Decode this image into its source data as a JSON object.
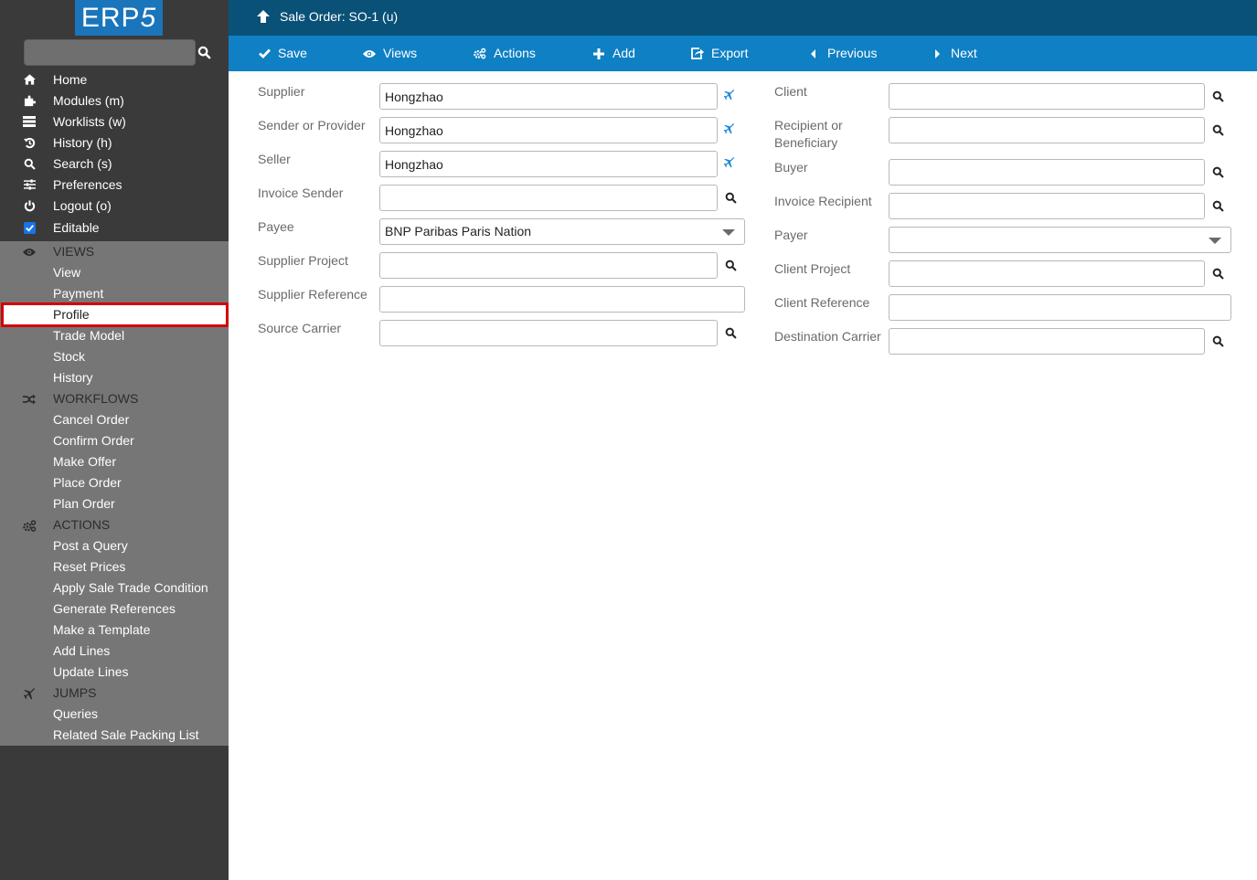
{
  "app": {
    "logo_text": "ERP",
    "logo_suffix": "5"
  },
  "sidebar": {
    "search_placeholder": "",
    "items": [
      {
        "label": "Home",
        "icon": "home-icon"
      },
      {
        "label": "Modules (m)",
        "icon": "puzzle-icon"
      },
      {
        "label": "Worklists (w)",
        "icon": "worklist-icon"
      },
      {
        "label": "History (h)",
        "icon": "history-icon"
      },
      {
        "label": "Search (s)",
        "icon": "search-icon"
      },
      {
        "label": "Preferences",
        "icon": "sliders-icon"
      },
      {
        "label": "Logout (o)",
        "icon": "power-icon"
      },
      {
        "label": "Editable",
        "icon": "checkbox-icon",
        "checked": true
      }
    ],
    "sections": {
      "views": {
        "title": "VIEWS",
        "items": [
          "View",
          "Payment",
          "Profile",
          "Trade Model",
          "Stock",
          "History"
        ],
        "active": "Profile"
      },
      "workflows": {
        "title": "WORKFLOWS",
        "items": [
          "Cancel Order",
          "Confirm Order",
          "Make Offer",
          "Place Order",
          "Plan Order"
        ]
      },
      "actions": {
        "title": "ACTIONS",
        "items": [
          "Post a Query",
          "Reset Prices",
          "Apply Sale Trade Condition",
          "Generate References",
          "Make a Template",
          "Add Lines",
          "Update Lines"
        ]
      },
      "jumps": {
        "title": "JUMPS",
        "items": [
          "Queries",
          "Related Sale Packing List"
        ]
      }
    }
  },
  "header": {
    "title": "Sale Order: SO-1 (u)"
  },
  "toolbar": {
    "save": "Save",
    "views": "Views",
    "actions": "Actions",
    "add": "Add",
    "export": "Export",
    "previous": "Previous",
    "next": "Next"
  },
  "form": {
    "left": [
      {
        "label": "Supplier",
        "value": "Hongzhao",
        "type": "relation",
        "action": "jump"
      },
      {
        "label": "Sender or Provider",
        "value": "Hongzhao",
        "type": "relation",
        "action": "jump"
      },
      {
        "label": "Seller",
        "value": "Hongzhao",
        "type": "relation",
        "action": "jump"
      },
      {
        "label": "Invoice Sender",
        "value": "",
        "type": "relation",
        "action": "search"
      },
      {
        "label": "Payee",
        "value": "BNP Paribas Paris Nation",
        "type": "select"
      },
      {
        "label": "Supplier Project",
        "value": "",
        "type": "relation",
        "action": "search"
      },
      {
        "label": "Supplier Reference",
        "value": "",
        "type": "text"
      },
      {
        "label": "Source Carrier",
        "value": "",
        "type": "relation",
        "action": "search"
      }
    ],
    "right": [
      {
        "label": "Client",
        "value": "",
        "type": "relation",
        "action": "search"
      },
      {
        "label": "Recipient or Beneficiary",
        "label_line1": "Recipient or",
        "label_line2": "Beneficiary",
        "value": "",
        "type": "relation",
        "action": "search"
      },
      {
        "label": "Buyer",
        "value": "",
        "type": "relation",
        "action": "search"
      },
      {
        "label": "Invoice Recipient",
        "value": "",
        "type": "relation",
        "action": "search"
      },
      {
        "label": "Payer",
        "value": "",
        "type": "select"
      },
      {
        "label": "Client Project",
        "value": "",
        "type": "relation",
        "action": "search"
      },
      {
        "label": "Client Reference",
        "value": "",
        "type": "text"
      },
      {
        "label": "Destination Carrier",
        "value": "",
        "type": "relation",
        "action": "search"
      }
    ]
  },
  "colors": {
    "header": "#0a5177",
    "toolbar": "#0f80c4",
    "sidebar": "#3a3a3a",
    "panel": "#767676",
    "active_outline": "#d40000",
    "jump_icon": "#1f8ad6"
  }
}
